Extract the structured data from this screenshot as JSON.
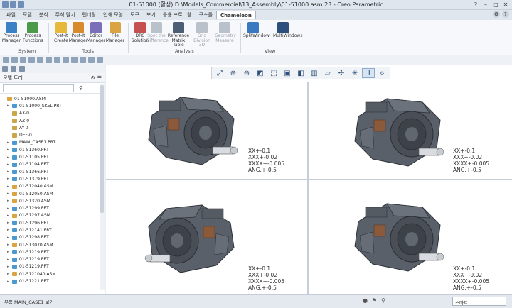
{
  "window": {
    "title": "01-51000 (활성) D:\\Models_Commercial\\13_Assembly\\01-51000.asm.23 - Creo Parametric",
    "controls": [
      "?",
      "–",
      "□",
      "✕"
    ]
  },
  "menu": {
    "tabs": [
      "파일",
      "모델",
      "분석",
      "주석 달기",
      "렌더링",
      "인쇄 모형",
      "도구",
      "보기",
      "응용 프로그램",
      "구조물",
      "Chameleon"
    ],
    "active_tab": "Chameleon"
  },
  "ribbon": {
    "buttons": [
      {
        "label": "Process Manager",
        "icon": "process-manager-icon",
        "color": "#3b7fc4",
        "enabled": true
      },
      {
        "label": "Process Functions",
        "icon": "process-functions-icon",
        "color": "#4a9a4a",
        "enabled": true
      },
      {
        "label": "Post-it Create",
        "icon": "post-it-create-icon",
        "color": "#e6b93a",
        "enabled": true
      },
      {
        "label": "Post-It Manager",
        "icon": "post-it-manager-icon",
        "color": "#d98a2a",
        "enabled": true
      },
      {
        "label": "Editor Manager",
        "icon": "editor-manager-icon",
        "color": "#7a6fb8",
        "enabled": true
      },
      {
        "label": "File Manager",
        "icon": "file-manager-icon",
        "color": "#d9a441",
        "enabled": true
      },
      {
        "label": "DRC Solution",
        "icon": "drc-solution-icon",
        "color": "#c65050",
        "enabled": true
      },
      {
        "label": "Spot the Difference",
        "icon": "spot-difference-icon",
        "color": "#b9c1ca",
        "enabled": false
      },
      {
        "label": "Reference Matrix Table",
        "icon": "reference-matrix-icon",
        "color": "#4c5e73",
        "enabled": true
      },
      {
        "label": "Grid Division 3D",
        "icon": "grid-division-icon",
        "color": "#b9c1ca",
        "enabled": false
      },
      {
        "label": "Geometry Measure",
        "icon": "geometry-measure-icon",
        "color": "#b9c1ca",
        "enabled": false
      },
      {
        "label": "SplitWindow",
        "icon": "split-window-icon",
        "color": "#3a78c0",
        "enabled": true
      },
      {
        "label": "MultiWindows",
        "icon": "multi-windows-icon",
        "color": "#2c4f7c",
        "enabled": true
      }
    ],
    "groups": [
      "System",
      "Tools",
      "Analysis",
      "View"
    ]
  },
  "model_tree": {
    "title": "모델 트리",
    "items": [
      {
        "label": "01-51000.ASM",
        "kind": "asm"
      },
      {
        "label": "01-51000_SKEL.PRT",
        "kind": "prt"
      },
      {
        "label": "AX-0",
        "kind": "axis"
      },
      {
        "label": "AZ-0",
        "kind": "datum"
      },
      {
        "label": "AY-0",
        "kind": "datum"
      },
      {
        "label": "DEF-0",
        "kind": "axis"
      },
      {
        "label": "MAIN_CASE1.PRT",
        "kind": "prt"
      },
      {
        "label": "01-51360.PRT",
        "kind": "prt"
      },
      {
        "label": "01-51105.PRT",
        "kind": "prt"
      },
      {
        "label": "01-51104.PRT",
        "kind": "prt"
      },
      {
        "label": "01-51366.PRT",
        "kind": "prt"
      },
      {
        "label": "01-51379.PRT",
        "kind": "prt"
      },
      {
        "label": "01-512040.ASM",
        "kind": "asm"
      },
      {
        "label": "01-512050.ASM",
        "kind": "asm"
      },
      {
        "label": "01-51320.ASM",
        "kind": "asm"
      },
      {
        "label": "01-51299.PRT",
        "kind": "prt"
      },
      {
        "label": "01-51297.ASM",
        "kind": "asm"
      },
      {
        "label": "01-51296.PRT",
        "kind": "prt"
      },
      {
        "label": "01-512141.PRT",
        "kind": "prt"
      },
      {
        "label": "01-51298.PRT",
        "kind": "prt"
      },
      {
        "label": "01-513070.ASM",
        "kind": "asm"
      },
      {
        "label": "01-51219.PRT",
        "kind": "prt"
      },
      {
        "label": "01-51219.PRT",
        "kind": "prt"
      },
      {
        "label": "01-51219.PRT",
        "kind": "prt"
      },
      {
        "label": "01-5121040.ASM",
        "kind": "asm"
      },
      {
        "label": "01-51221.PRT",
        "kind": "prt"
      }
    ]
  },
  "tolerance_note": [
    "XX+-0.1",
    "XXX+-0.02",
    "XXXX+-0.005",
    "ANG.+-0.5"
  ],
  "status": {
    "message": "부품 MAIN_CASE1 보기",
    "selection_filter": "스마트"
  },
  "colors": {
    "accent": "#2f5d9a",
    "body_dark": "#4a4f57",
    "bronze": "#8a5a3a"
  }
}
